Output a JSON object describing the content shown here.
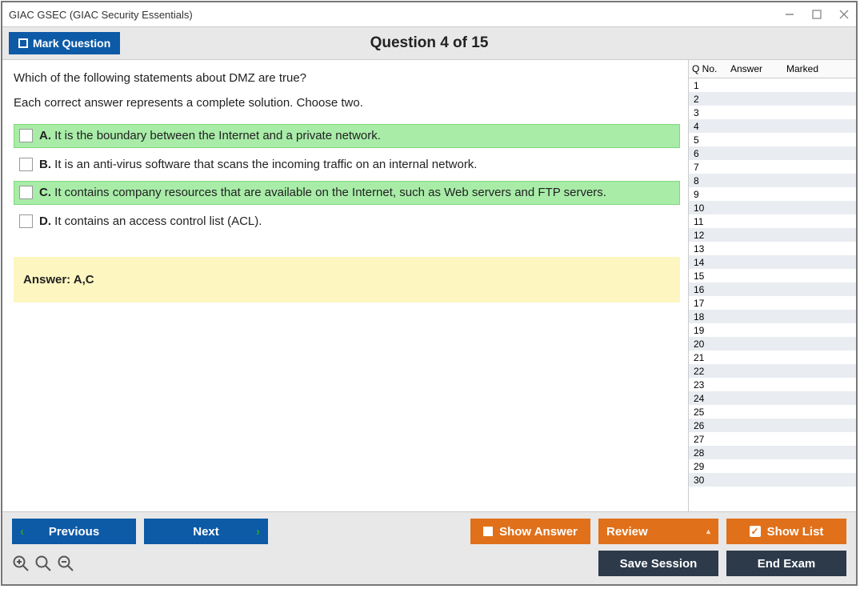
{
  "window": {
    "title": "GIAC GSEC (GIAC Security Essentials)"
  },
  "header": {
    "mark_label": "Mark Question",
    "question_label": "Question 4 of 15"
  },
  "question": {
    "stem1": "Which of the following statements about DMZ are true?",
    "stem2": "Each correct answer represents a complete solution. Choose two.",
    "options": {
      "a": {
        "letter": "A.",
        "text": " It is the boundary between the Internet and a private network."
      },
      "b": {
        "letter": "B.",
        "text": " It is an anti-virus software that scans the incoming traffic on an internal network."
      },
      "c": {
        "letter": "C.",
        "text": " It contains company resources that are available on the Internet, such as Web servers and FTP servers."
      },
      "d": {
        "letter": "D.",
        "text": " It contains an access control list (ACL)."
      }
    },
    "answer_label": "Answer: A,C"
  },
  "side": {
    "head_no": "Q No.",
    "head_ans": "Answer",
    "head_mk": "Marked",
    "rows": [
      "1",
      "2",
      "3",
      "4",
      "5",
      "6",
      "7",
      "8",
      "9",
      "10",
      "11",
      "12",
      "13",
      "14",
      "15",
      "16",
      "17",
      "18",
      "19",
      "20",
      "21",
      "22",
      "23",
      "24",
      "25",
      "26",
      "27",
      "28",
      "29",
      "30"
    ]
  },
  "nav": {
    "previous": "Previous",
    "next": "Next",
    "show_answer": "Show Answer",
    "review": "Review",
    "show_list": "Show List",
    "save_session": "Save Session",
    "end_exam": "End Exam"
  }
}
